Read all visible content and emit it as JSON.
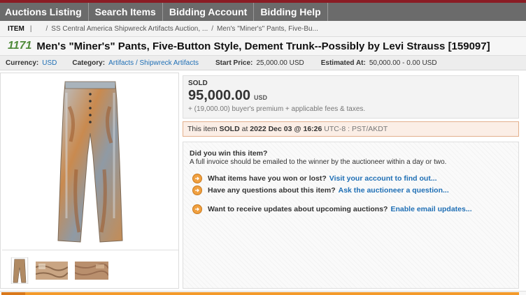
{
  "nav": {
    "items": [
      {
        "label": "Auctions Listing"
      },
      {
        "label": "Search Items"
      },
      {
        "label": "Bidding Account"
      },
      {
        "label": "Bidding Help"
      }
    ]
  },
  "breadcrumb": {
    "item_label": "ITEM",
    "sep": "/",
    "links": [
      "SS Central America Shipwreck Artifacts Auction, ...",
      "Men's \"Miner's\" Pants, Five-Bu..."
    ]
  },
  "lot": {
    "number": "1171",
    "title": "Men's \"Miner's\" Pants, Five-Button Style, Dement Trunk--Possibly by Levi Strauss [159097]"
  },
  "meta": {
    "currency_label": "Currency:",
    "currency_value": "USD",
    "category_label": "Category:",
    "category_value": "Artifacts / Shipwreck Artifacts",
    "start_price_label": "Start Price:",
    "start_price_value": "25,000.00 USD",
    "estimate_label": "Estimated At:",
    "estimate_value": "50,000.00 - 0.00 USD"
  },
  "sale": {
    "status": "SOLD",
    "price": "95,000.00",
    "currency": "USD",
    "premium_note": "+ (19,000.00) buyer's premium + applicable fees & taxes.",
    "sold_at_prefix": "This item",
    "sold_at_status": "SOLD",
    "sold_at_mid": "at",
    "sold_at_datetime": "2022 Dec 03 @ 16:26",
    "sold_at_tz": "UTC-8 : PST/AKDT"
  },
  "win": {
    "title": "Did you win this item?",
    "desc": "A full invoice should be emailed to the winner by the auctioneer within a day or two.",
    "rows": [
      {
        "text": "What items have you won or lost?",
        "link": "Visit your account to find out..."
      },
      {
        "text": "Have any questions about this item?",
        "link": "Ask the auctioneer a question..."
      },
      {
        "text": "Want to receive updates about upcoming auctions?",
        "link": "Enable email updates..."
      }
    ]
  },
  "icons": {
    "help": "arrow-circle-icon",
    "accent_color": "#f39a2b",
    "link_color": "#1f6fb5",
    "nav_color": "#6b6b6b",
    "lot_number_color": "#4f8a3a"
  }
}
